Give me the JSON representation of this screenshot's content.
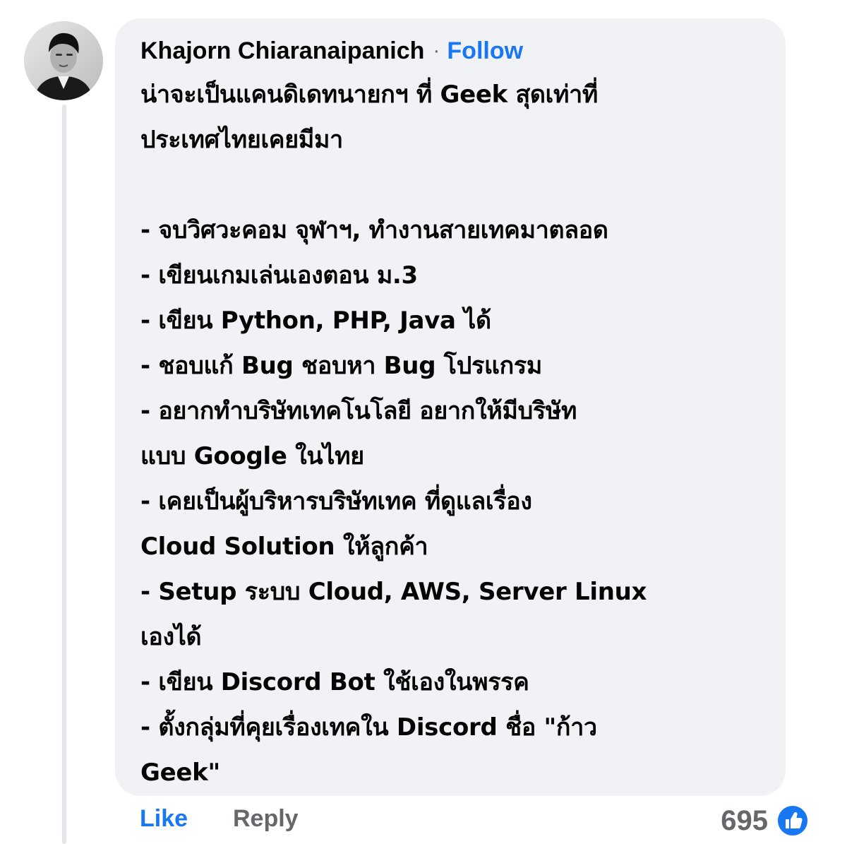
{
  "comment": {
    "author": "Khajorn Chiaranaipanich",
    "separator": "·",
    "follow_label": "Follow",
    "text": "น่าจะเป็นแคนดิเดทนายกฯ ที่ Geek สุดเท่าที่\nประเทศไทยเคยมีมา\n\n- จบวิศวะคอม จุฬาฯ, ทำงานสายเทคมาตลอด\n- เขียนเกมเล่นเองตอน ม.3\n- เขียน Python, PHP, Java ได้\n- ชอบแก้ Bug ชอบหา Bug โปรแกรม\n- อยากทำบริษัทเทคโนโลยี อยากให้มีบริษัท\nแบบ Google ในไทย\n- เคยเป็นผู้บริหารบริษัทเทค ที่ดูแลเรื่อง\nCloud Solution ให้ลูกค้า\n- Setup ระบบ Cloud, AWS, Server Linux\nเองได้\n- เขียน Discord Bot ใช้เองในพรรค\n- ตั้งกลุ่มที่คุยเรื่องเทคใน Discord ชื่อ \"ก้าว\nGeek\""
  },
  "actions": {
    "like_label": "Like",
    "reply_label": "Reply",
    "reaction_count": "695",
    "reaction_icon": "like-reaction-icon"
  },
  "colors": {
    "accent": "#1877f2",
    "muted": "#65676b",
    "bubble": "#f0f2f5"
  }
}
